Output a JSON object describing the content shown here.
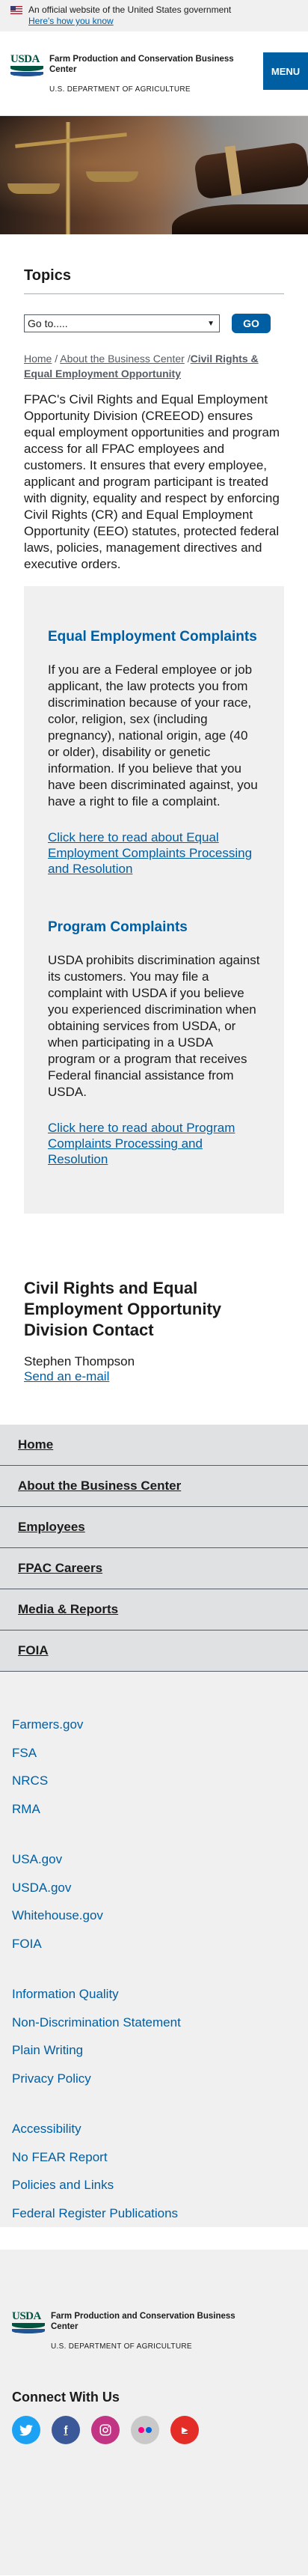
{
  "gov_banner": {
    "text": "An official website of the United States government",
    "link": "Here's how you know"
  },
  "header": {
    "agency": "Farm Production and Conservation Business Center",
    "department": "U.S. DEPARTMENT OF AGRICULTURE",
    "logo_text": "USDA",
    "menu_label": "MENU"
  },
  "topics": {
    "heading": "Topics",
    "select_value": "Go to.....",
    "go_label": "GO"
  },
  "breadcrumb": {
    "home": "Home",
    "sep1": " /",
    "about": "About the Business Center",
    "sep2": " /",
    "current": "Civil Rights & Equal Employment Opportunity"
  },
  "intro": "FPAC's Civil Rights and Equal Employment Opportunity Division (CREEOD) ensures equal employment opportunities and program access for all FPAC employees and customers. It ensures that every employee, applicant and program participant is treated with dignity, equality and respect by enforcing Civil Rights (CR) and Equal Employment Opportunity (EEO) statutes, protected federal laws, policies, management directives and executive orders.",
  "eeo_complaints": {
    "heading": "Equal Employment Complaints",
    "body": "If you are a Federal employee or job applicant, the law protects you from discrimination because of your race, color, religion, sex (including pregnancy), national origin, age (40 or older), disability or genetic information. If you believe that you have been discriminated against, you have a right to file a complaint.",
    "link": "Click here to read about Equal Employment Complaints Processing and Resolution"
  },
  "program_complaints": {
    "heading": "Program Complaints",
    "body": "USDA prohibits discrimination against its customers. You may file a complaint with USDA if you believe you experienced discrimination when obtaining services from USDA, or when participating in a USDA program or a program that receives Federal financial assistance from USDA.",
    "link": "Click here to read about Program Complaints Processing and Resolution"
  },
  "contact": {
    "heading": "Civil Rights and Equal Employment Opportunity Division Contact",
    "name": "Stephen Thompson",
    "email": "Send an e-mail"
  },
  "footer_nav": [
    "Home",
    "About the Business Center",
    "Employees",
    "FPAC Careers",
    "Media & Reports",
    "FOIA"
  ],
  "footer_links": {
    "group1": [
      "Farmers.gov",
      "FSA",
      "NRCS",
      "RMA"
    ],
    "group2": [
      "USA.gov",
      "USDA.gov",
      "Whitehouse.gov",
      "FOIA"
    ],
    "group3": [
      "Information Quality",
      "Non-Discrimination Statement",
      "Plain Writing",
      "Privacy Policy"
    ],
    "group4": [
      "Accessibility",
      "No FEAR Report",
      "Policies and Links",
      "Federal Register Publications"
    ]
  },
  "connect": {
    "heading": "Connect With Us",
    "icons": [
      "twitter-icon",
      "facebook-icon",
      "instagram-icon",
      "flickr-icon",
      "youtube-icon"
    ]
  },
  "colors": {
    "primary": "#005ea2",
    "usda_green": "#005440",
    "footer_nav_bg": "#dfe1e2",
    "box_bg": "#f0f0f0"
  }
}
